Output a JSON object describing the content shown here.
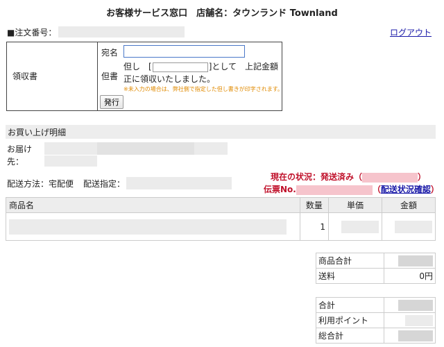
{
  "header": {
    "title": "お客様サービス窓口　店舗名：タウンランド Townland"
  },
  "order": {
    "label": "■注文番号："
  },
  "nav": {
    "logout": "ログアウト"
  },
  "receipt": {
    "label": "領収書",
    "addressee_label": "宛名",
    "addressee_value": "",
    "proviso_label": "但書",
    "proviso_prefix": "但し　[",
    "proviso_suffix": "]として　上記金額",
    "proviso_line2": "正に領収いたしました。",
    "note": "※未入力の場合は、弊社側で指定した但し書きが印字されます。",
    "issue_button": "発行"
  },
  "details": {
    "section_title": "お買い上げ明細",
    "deliver_label": "お届け先：",
    "method_label": "配送方法：宅配便",
    "shipto_label": "配送指定：",
    "status_text": "現在の状況：発送済み（",
    "status_close": "）",
    "slip_label": "伝票No.",
    "slip_open": "（",
    "slip_link": "配送状況確認",
    "slip_close": "）"
  },
  "items": {
    "columns": [
      "商品名",
      "数量",
      "単価",
      "金額"
    ],
    "rows": [
      {
        "name": "",
        "qty": "1",
        "unit_price": "",
        "amount": ""
      }
    ]
  },
  "totals": {
    "subtotal_label": "商品合計",
    "shipping_label": "送料",
    "shipping_value": "0円",
    "total_label": "合計",
    "points_label": "利用ポイント",
    "grand_total_label": "総合計"
  }
}
